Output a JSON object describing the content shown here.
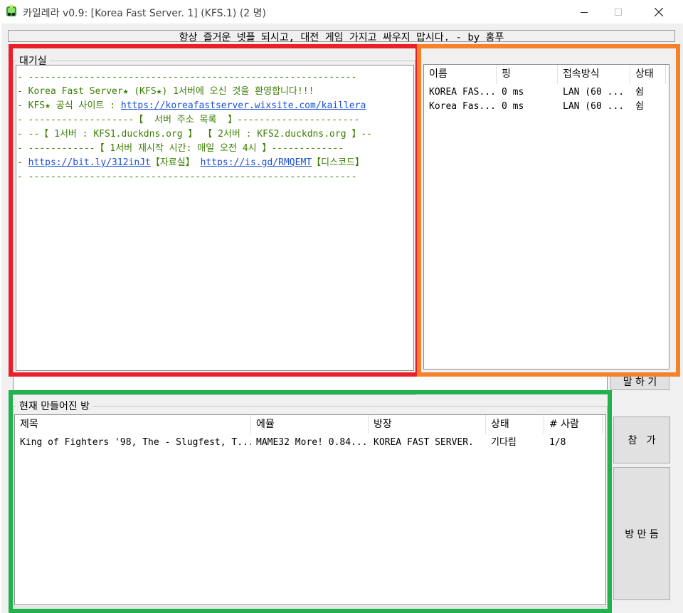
{
  "window": {
    "title": "카일레라 v0.9: [Korea Fast Server. 1] (KFS.1) (2 명)"
  },
  "banner": "항상 즐거운 넷플 되시고, 대전 게임 가지고 싸우지 맙시다. - by 홍푸",
  "lobby": {
    "title": "대기실",
    "lines": [
      {
        "parts": [
          {
            "text": "- -----------------------------------------------------------",
            "link": false
          }
        ]
      },
      {
        "parts": [
          {
            "text": "- Korea Fast Server★ (KFS★) 1서버에 오신 것을 환영합니다!!!",
            "link": false
          }
        ]
      },
      {
        "parts": [
          {
            "text": "- KFS★ 공식 사이트 : ",
            "link": false
          },
          {
            "text": "https://koreafastserver.wixsite.com/kaillera",
            "link": true
          }
        ]
      },
      {
        "parts": [
          {
            "text": "- -------------------【  서버 주소 목록  】----------------------",
            "link": false
          }
        ]
      },
      {
        "parts": [
          {
            "text": "- --【 1서버 : KFS1.duckdns.org 】 【 2서버 : KFS2.duckdns.org 】--",
            "link": false
          }
        ]
      },
      {
        "parts": [
          {
            "text": "- ------------【 1서버 재시작 시간: 매일 오전 4시 】-------------",
            "link": false
          }
        ]
      },
      {
        "parts": [
          {
            "text": "- ",
            "link": false
          },
          {
            "text": "https://bit.ly/312inJt",
            "link": true
          },
          {
            "text": "【자료실】 ",
            "link": false
          },
          {
            "text": "https://is.gd/RMQEMT",
            "link": true
          },
          {
            "text": "【디스코드】",
            "link": false
          }
        ]
      },
      {
        "parts": [
          {
            "text": "- -----------------------------------------------------------",
            "link": false
          }
        ]
      }
    ]
  },
  "users": {
    "columns": [
      "이름",
      "핑",
      "접속방식",
      "상태"
    ],
    "rows": [
      [
        "KOREA FAS...",
        "0 ms",
        "LAN (60 ...",
        "쉼"
      ],
      [
        "Korea Fas...",
        "0 ms",
        "LAN (60 ...",
        "쉼"
      ]
    ]
  },
  "chat": {
    "input_value": "",
    "send_label": "말 하 기"
  },
  "rooms": {
    "title": "현재 만들어진 방",
    "columns": [
      "제목",
      "에뮬",
      "방장",
      "상태",
      "# 사람"
    ],
    "rows": [
      [
        "King of Fighters '98, The - Slugfest, T...",
        "MAME32 More! 0.84...",
        "KOREA FAST SERVER.",
        "기다림",
        "1/8"
      ]
    ]
  },
  "buttons": {
    "join": "참   가",
    "create": "방 만 듬"
  },
  "highlights": {
    "red": "#e8202a",
    "orange": "#f5822a",
    "green": "#22b24c"
  }
}
